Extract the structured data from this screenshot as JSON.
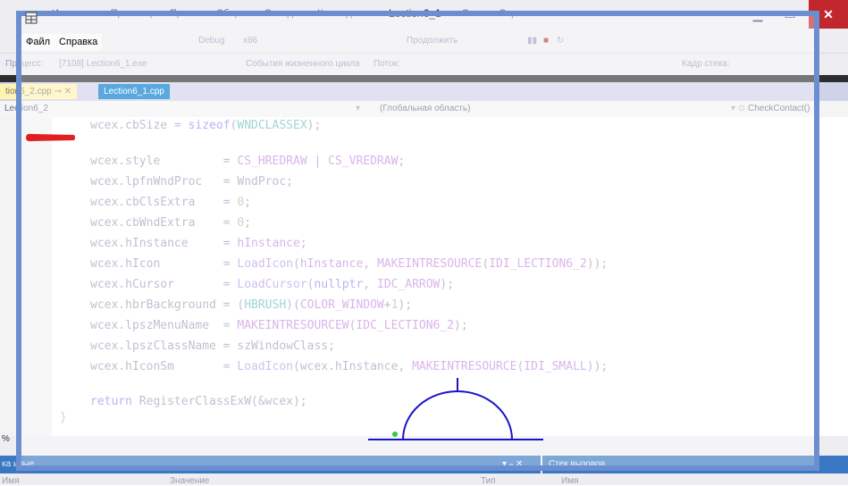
{
  "ide": {
    "title": "Lection6_1",
    "title_overlap": "ст",
    "menu": [
      "Изменить",
      "Просмотр",
      "Проект",
      "Сборка",
      "Отладка",
      "Команда",
      "Окно",
      "Справка"
    ],
    "toolbar": {
      "debug_label": "Debug",
      "platform_label": "x86",
      "continue_label": "Продолжить",
      "stack_frame_label": "Кадр стека:"
    },
    "process_label": "Процесс:",
    "process_value": "[7108] Lection6_1.exe",
    "lifecycle_label": "События жизненного цикла",
    "thread_label": "Поток:",
    "tabs": [
      {
        "label": "tion6_2.cpp"
      },
      {
        "label": "Lection6_1.cpp"
      }
    ],
    "nav": {
      "project": "Lection6_2",
      "scope": "(Глобальная область)",
      "member": "CheckContact()"
    },
    "code": {
      "line1": [
        "wcex.cbSize = ",
        "sizeof",
        "(",
        "WNDCLASSEX",
        ");"
      ],
      "rows": [
        {
          "field": "wcex.style         ",
          "eq": "= ",
          "parts": [
            [
              "c-macro",
              "CS_HREDRAW"
            ],
            [
              "c-plain",
              " | "
            ],
            [
              "c-macro",
              "CS_VREDRAW"
            ],
            [
              "c-plain",
              ";"
            ]
          ]
        },
        {
          "field": "wcex.lpfnWndProc   ",
          "eq": "= ",
          "parts": [
            [
              "c-plain",
              "WndProc;"
            ]
          ]
        },
        {
          "field": "wcex.cbClsExtra    ",
          "eq": "= ",
          "parts": [
            [
              "c-num",
              "0"
            ],
            [
              "c-plain",
              ";"
            ]
          ]
        },
        {
          "field": "wcex.cbWndExtra    ",
          "eq": "= ",
          "parts": [
            [
              "c-num",
              "0"
            ],
            [
              "c-plain",
              ";"
            ]
          ]
        },
        {
          "field": "wcex.hInstance     ",
          "eq": "= ",
          "parts": [
            [
              "c-macro",
              "hInstance"
            ],
            [
              "c-plain",
              ";"
            ]
          ]
        },
        {
          "field": "wcex.hIcon         ",
          "eq": "= ",
          "parts": [
            [
              "c-fn",
              "LoadIcon"
            ],
            [
              "c-plain",
              "("
            ],
            [
              "c-macro",
              "hInstance"
            ],
            [
              "c-plain",
              ", "
            ],
            [
              "c-macro",
              "MAKEINTRESOURCE"
            ],
            [
              "c-plain",
              "("
            ],
            [
              "c-macro",
              "IDI_LECTION6_2"
            ],
            [
              "c-plain",
              "));"
            ]
          ]
        },
        {
          "field": "wcex.hCursor       ",
          "eq": "= ",
          "parts": [
            [
              "c-fn",
              "LoadCursor"
            ],
            [
              "c-plain",
              "("
            ],
            [
              "c-key",
              "nullptr"
            ],
            [
              "c-plain",
              ", "
            ],
            [
              "c-macro",
              "IDC_ARROW"
            ],
            [
              "c-plain",
              ");"
            ]
          ]
        },
        {
          "field": "wcex.hbrBackground ",
          "eq": "= ",
          "parts": [
            [
              "c-plain",
              "("
            ],
            [
              "c-type",
              "HBRUSH"
            ],
            [
              "c-plain",
              ")("
            ],
            [
              "c-macro",
              "COLOR_WINDOW"
            ],
            [
              "c-plain",
              "+"
            ],
            [
              "c-num",
              "1"
            ],
            [
              "c-plain",
              ");"
            ]
          ]
        },
        {
          "field": "wcex.lpszMenuName  ",
          "eq": "= ",
          "parts": [
            [
              "c-macro",
              "MAKEINTRESOURCEW"
            ],
            [
              "c-plain",
              "("
            ],
            [
              "c-macro",
              "IDC_LECTION6_2"
            ],
            [
              "c-plain",
              ");"
            ]
          ]
        },
        {
          "field": "wcex.lpszClassName ",
          "eq": "= ",
          "parts": [
            [
              "c-plain",
              "szWindowClass;"
            ]
          ]
        },
        {
          "field": "wcex.hIconSm       ",
          "eq": "= ",
          "parts": [
            [
              "c-fn",
              "LoadIcon"
            ],
            [
              "c-plain",
              "(wcex.hInstance, "
            ],
            [
              "c-macro",
              "MAKEINTRESOURCE"
            ],
            [
              "c-plain",
              "("
            ],
            [
              "c-macro",
              "IDI_SMALL"
            ],
            [
              "c-plain",
              "));"
            ]
          ]
        }
      ],
      "return_kw": "return",
      "return_rest": " RegisterClassExW(&wcex);",
      "close_brace": "}"
    },
    "zoom": "%",
    "bottom_left_title": "ка  ьные",
    "bottom_left_pin": "▾ ᵩ ✕",
    "bottom_right_title": "Стек вызовов",
    "col_left": "Значение",
    "col_lang": "Тип",
    "col_name": "Имя"
  },
  "app": {
    "menu": [
      "Файл",
      "Справка"
    ]
  },
  "colors": {
    "overlay_border": "#6a8ed0",
    "drawing_blue": "#1a14c8",
    "red_mark": "#e02020",
    "green_dot": "#2ecc40"
  }
}
